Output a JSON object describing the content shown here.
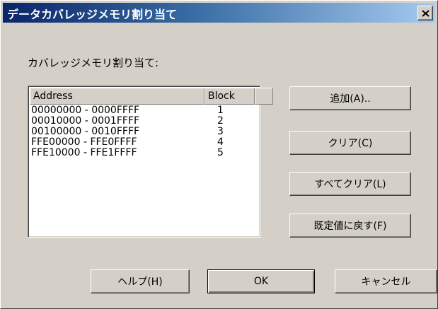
{
  "window": {
    "title": "データカバレッジメモリ割り当て",
    "close_glyph": "✕"
  },
  "group_label": "カバレッジメモリ割り当て:",
  "list": {
    "columns": [
      "Address",
      "Block",
      ""
    ],
    "rows": [
      {
        "address": "00000000 - 0000FFFF",
        "block": "1"
      },
      {
        "address": "00010000 - 0001FFFF",
        "block": "2"
      },
      {
        "address": "00100000 - 0010FFFF",
        "block": "3"
      },
      {
        "address": "FFE00000 - FFE0FFFF",
        "block": "4"
      },
      {
        "address": "FFE10000 - FFE1FFFF",
        "block": "5"
      }
    ]
  },
  "buttons": {
    "add": "追加(A)..",
    "clear": "クリア(C)",
    "clear_all": "すべてクリア(L)",
    "restore_default": "既定値に戻す(F)",
    "help": "ヘルプ(H)",
    "ok": "OK",
    "cancel": "キャンセル"
  }
}
